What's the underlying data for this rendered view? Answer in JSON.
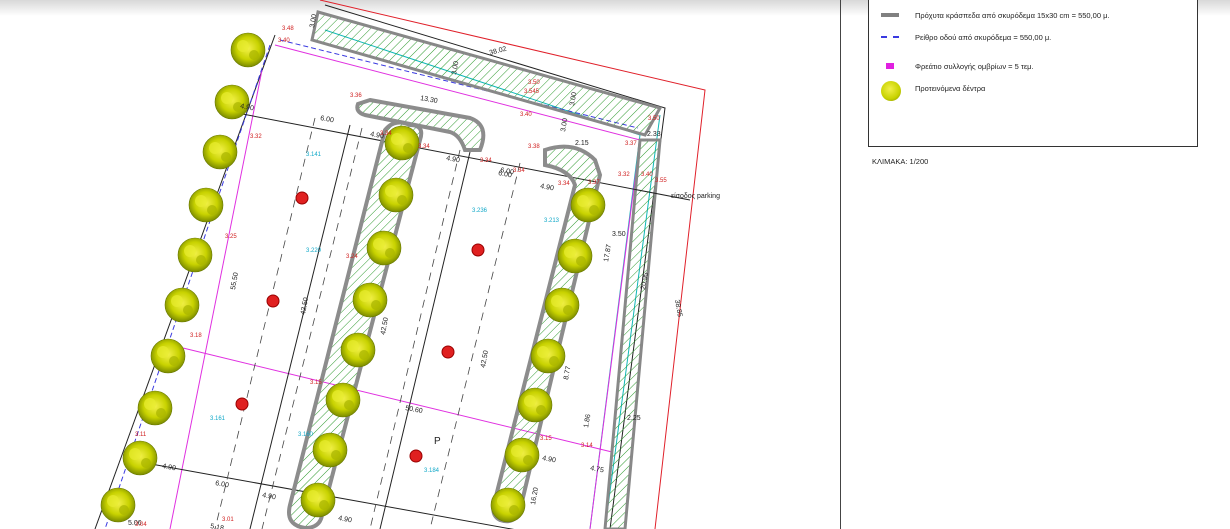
{
  "legend": {
    "items": [
      {
        "id": "curb",
        "text": "Πρόχυτα κράσπεδα από σκυρόδεμα 15x30 cm = 550,00 μ.",
        "symbol": "gray-bar-icon",
        "color": "#808080"
      },
      {
        "id": "gutter",
        "text": "Ρείθρο οδού από σκυρόδεμα = 550,00 μ.",
        "symbol": "dashed-blue-line-icon",
        "color": "#3a3ae0"
      },
      {
        "id": "drain",
        "text": "Φρεάτιο συλλογής ομβρίων = 5 τεμ.",
        "symbol": "magenta-square-icon",
        "color": "#e020e0"
      },
      {
        "id": "trees",
        "text": "Προτεινόμενα δέντρα",
        "symbol": "tree-icon",
        "color": "#c8d400"
      }
    ]
  },
  "scale": "ΚΛΙΜΑΚΑ: 1/200",
  "plan": {
    "entrance_label": "είσοδος parking",
    "parking_label": "P",
    "dimensions": [
      "38.02",
      "13.30",
      "4.90",
      "6.00",
      "4.90",
      "4.90",
      "6.00",
      "4.90",
      "2.33",
      "3.50",
      "17.87",
      "20.95",
      "38.85",
      "42.50",
      "42.50",
      "42.50",
      "55.50",
      "50.60",
      "8.77",
      "2.25",
      "4.90",
      "6.00",
      "4.90",
      "4.90",
      "4.90",
      "4.75",
      "5.06",
      "16.20",
      "3.00",
      "3.00",
      "3.00",
      "3.00",
      "2.15",
      "1.86",
      "6.00",
      "5.18"
    ],
    "elevations": [
      "3.48",
      "3.40",
      "3.36",
      "3.34",
      "3.34",
      "3.50",
      "3.545",
      "3.40",
      "3.34",
      "3.38",
      "3.34",
      "3.34",
      "3.32",
      "3.25",
      "3.24",
      "3.18",
      "3.15",
      "3.11",
      "3.15",
      "3.14",
      "3.01",
      "3.04",
      "3.50",
      "3.37",
      "3.40",
      "3.55",
      "3.32",
      "3.37"
    ],
    "cyan_marks": [
      "3.141",
      "3.220",
      "3.236",
      "3.213",
      "3.161",
      "3.160",
      "3.184"
    ],
    "colors": {
      "curb": "#8c8c8c",
      "property_line": "#e0202a",
      "pink_line": "#e030e0",
      "cyan_line": "#10b8b8",
      "hatch": "#2f9a2f",
      "tree": "#c8d200",
      "tree_dark": "#7a8a00"
    }
  }
}
